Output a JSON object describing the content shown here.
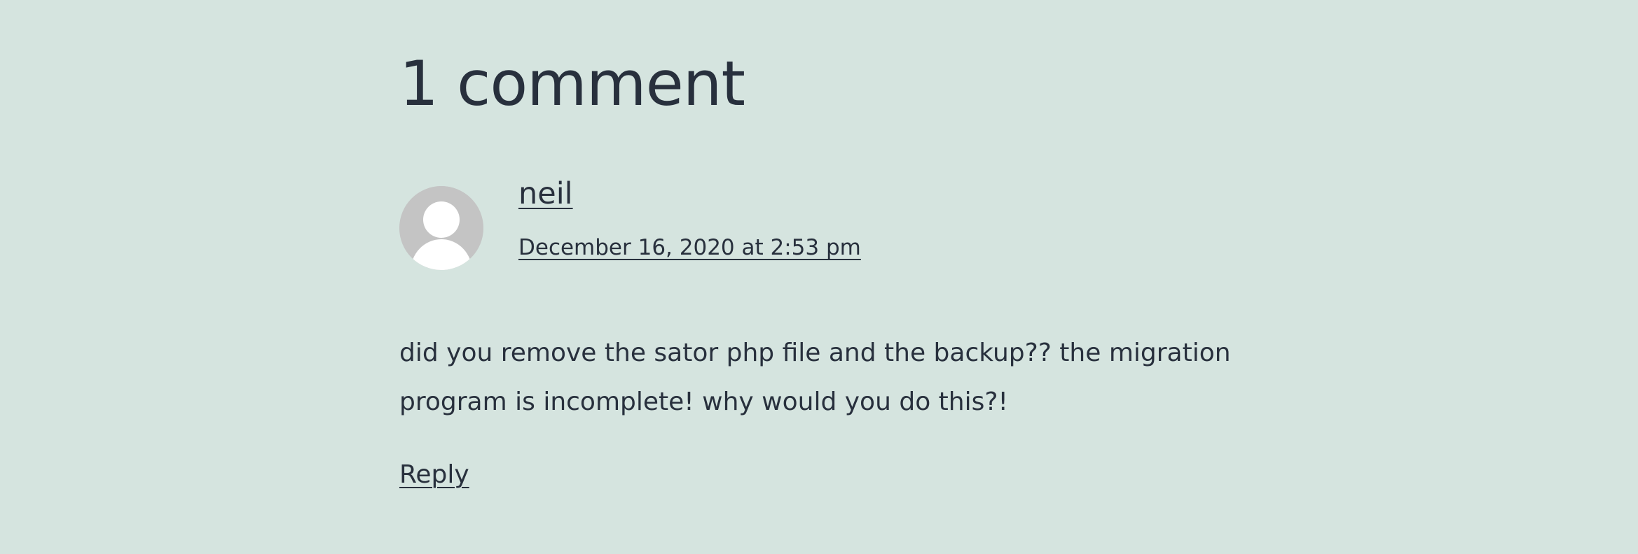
{
  "comments": {
    "title": "1 comment",
    "items": [
      {
        "author": "neil",
        "date": "December 16, 2020 at 2:53 pm",
        "text": "did you remove the sator php file and the backup?? the migration program is incomplete! why would you do this?!",
        "reply_label": "Reply",
        "avatar_icon": "default-user-avatar-icon"
      }
    ]
  },
  "colors": {
    "background": "#d5e4df",
    "text": "#28303d",
    "avatar_bg": "#c4c4c4",
    "avatar_figure": "#ffffff"
  }
}
